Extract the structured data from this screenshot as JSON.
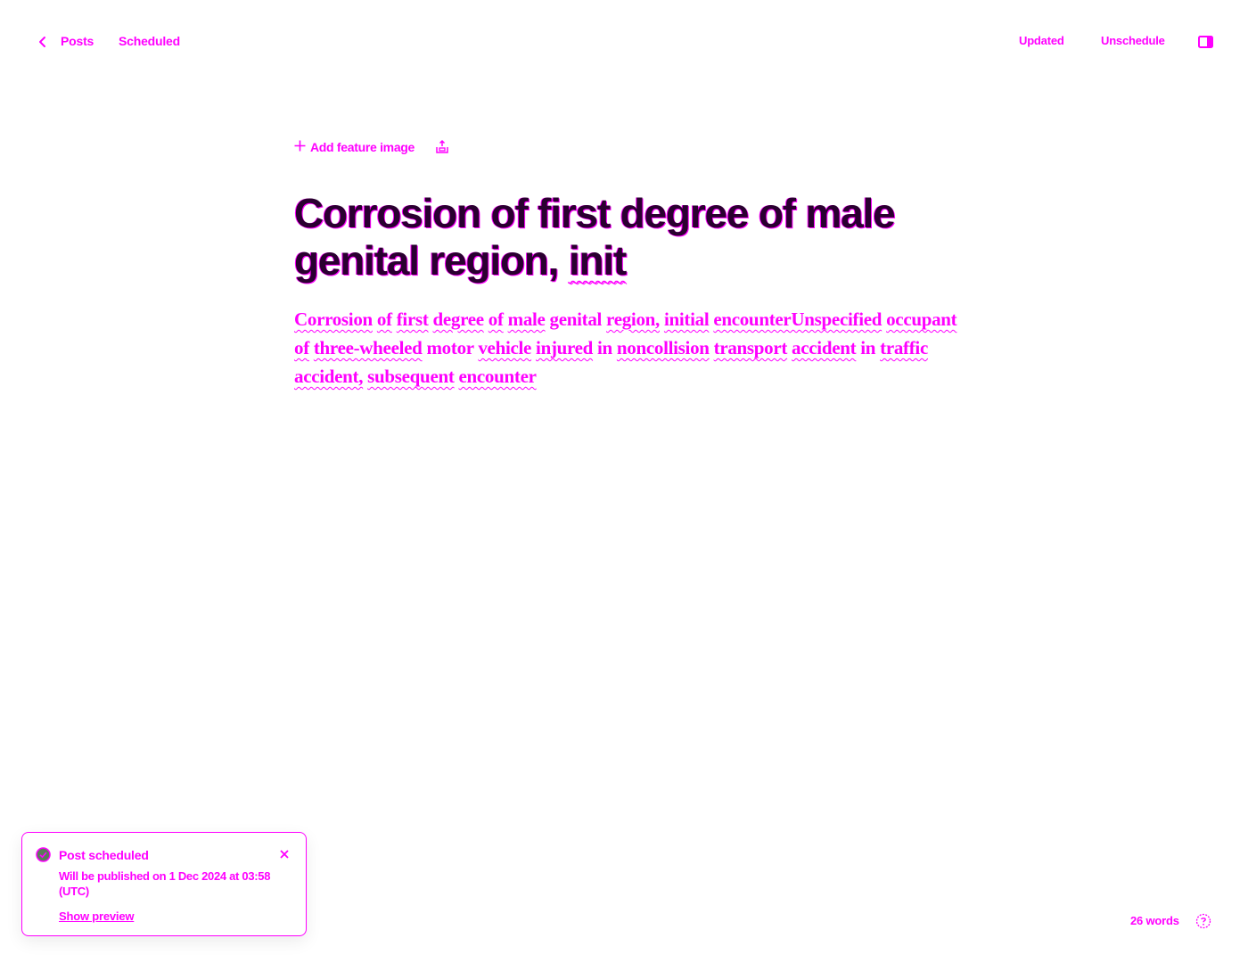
{
  "header": {
    "back_label": "Posts",
    "status": "Scheduled",
    "updated_label": "Updated",
    "unschedule_label": "Unschedule"
  },
  "editor": {
    "add_feature_image": "Add feature image",
    "title_part1": "Corrosion of first degree of male genital region, ",
    "title_part2": "init",
    "body_words": [
      {
        "t": "Corrosion",
        "err": true
      },
      {
        "t": " ",
        "err": false
      },
      {
        "t": "of",
        "err": true
      },
      {
        "t": " ",
        "err": false
      },
      {
        "t": "first",
        "err": true
      },
      {
        "t": " ",
        "err": false
      },
      {
        "t": "degree",
        "err": true
      },
      {
        "t": " ",
        "err": false
      },
      {
        "t": "of",
        "err": true
      },
      {
        "t": " ",
        "err": false
      },
      {
        "t": "male",
        "err": true
      },
      {
        "t": " genital ",
        "err": false
      },
      {
        "t": "region,",
        "err": true
      },
      {
        "t": " ",
        "err": false
      },
      {
        "t": "initial",
        "err": true
      },
      {
        "t": " ",
        "err": false
      },
      {
        "t": "encounterUnspecified",
        "err": true
      },
      {
        "t": " ",
        "err": false
      },
      {
        "t": "occupant",
        "err": true
      },
      {
        "t": " ",
        "err": false
      },
      {
        "t": "of",
        "err": true
      },
      {
        "t": " ",
        "err": false
      },
      {
        "t": "three-wheeled",
        "err": true
      },
      {
        "t": " motor ",
        "err": false
      },
      {
        "t": "vehicle",
        "err": true
      },
      {
        "t": " ",
        "err": false
      },
      {
        "t": "injured",
        "err": true
      },
      {
        "t": " in ",
        "err": false
      },
      {
        "t": "noncollision",
        "err": true
      },
      {
        "t": " ",
        "err": false
      },
      {
        "t": "transport",
        "err": true
      },
      {
        "t": " ",
        "err": false
      },
      {
        "t": "accident",
        "err": true
      },
      {
        "t": " in ",
        "err": false
      },
      {
        "t": "traffic",
        "err": true
      },
      {
        "t": " ",
        "err": false
      },
      {
        "t": "accident,",
        "err": true
      },
      {
        "t": " ",
        "err": false
      },
      {
        "t": "subsequent",
        "err": true
      },
      {
        "t": " ",
        "err": false
      },
      {
        "t": "encounter",
        "err": true
      }
    ]
  },
  "toast": {
    "title": "Post scheduled",
    "message": "Will be published on 1 Dec 2024 at 03:58 (UTC)",
    "link": "Show preview"
  },
  "footer": {
    "word_count": "26 words"
  },
  "colors": {
    "accent": "#ff00ff",
    "title_fill": "#2a0030"
  },
  "icons": [
    "chevron-left-icon",
    "sidebar-panel-icon",
    "plus-icon",
    "snippet-icon",
    "check-circle-icon",
    "close-icon",
    "help-circle-icon"
  ]
}
